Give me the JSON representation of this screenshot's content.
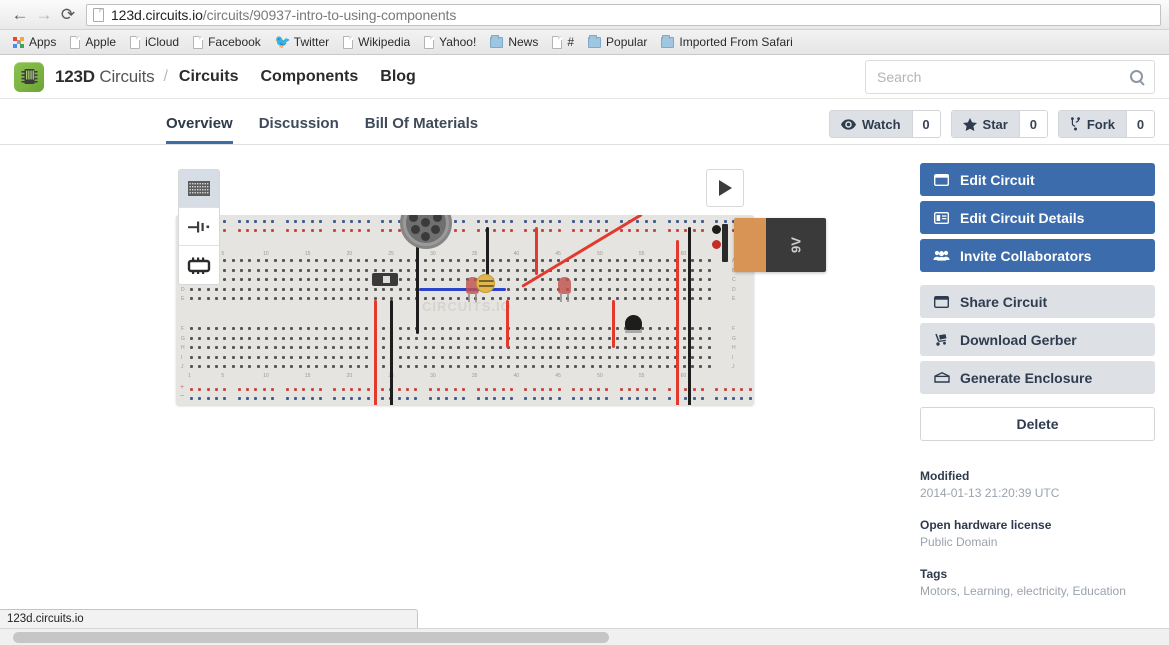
{
  "browser": {
    "back_icon": "back-arrow-icon",
    "forward_icon": "forward-arrow-icon",
    "reload_icon": "reload-icon",
    "url_main": "123d.circuits.io",
    "url_path": "/circuits/90937-intro-to-using-components",
    "bookmarks": [
      {
        "label": "Apps",
        "icon": "apps-grid-icon"
      },
      {
        "label": "Apple",
        "icon": "document-icon"
      },
      {
        "label": "iCloud",
        "icon": "document-icon"
      },
      {
        "label": "Facebook",
        "icon": "document-icon"
      },
      {
        "label": "Twitter",
        "icon": "twitter-bird-icon"
      },
      {
        "label": "Wikipedia",
        "icon": "document-icon"
      },
      {
        "label": "Yahoo!",
        "icon": "document-icon"
      },
      {
        "label": "News",
        "icon": "folder-icon"
      },
      {
        "label": "#",
        "icon": "document-icon"
      },
      {
        "label": "Popular",
        "icon": "folder-icon"
      },
      {
        "label": "Imported From Safari",
        "icon": "folder-icon"
      }
    ],
    "status_text": "123d.circuits.io"
  },
  "header": {
    "brand_strong": "123D",
    "brand_light": "Circuits",
    "separator": "/",
    "nav": [
      {
        "label": "Circuits"
      },
      {
        "label": "Components"
      },
      {
        "label": "Blog"
      }
    ],
    "search_placeholder": "Search",
    "search_value": "",
    "search_icon": "search-icon"
  },
  "repo": {
    "tabs": [
      {
        "label": "Overview",
        "active": true
      },
      {
        "label": "Discussion",
        "active": false
      },
      {
        "label": "Bill Of Materials",
        "active": false
      }
    ],
    "social": [
      {
        "label": "Watch",
        "count": "0",
        "icon": "eye-icon"
      },
      {
        "label": "Star",
        "count": "0",
        "icon": "star-icon"
      },
      {
        "label": "Fork",
        "count": "0",
        "icon": "fork-icon"
      }
    ]
  },
  "viewer": {
    "tools": [
      {
        "name": "breadboard-view",
        "icon": "breadboard-icon",
        "active": true
      },
      {
        "name": "schematic-view",
        "icon": "schematic-icon",
        "active": false
      },
      {
        "name": "pcb-view",
        "icon": "chip-icon",
        "active": false
      }
    ],
    "play_icon": "play-triangle-icon",
    "watermark": "CIRCUITS.IO",
    "battery_label": "9V",
    "row_letters_top": [
      "A",
      "B",
      "C",
      "D",
      "E"
    ],
    "row_letters_bottom": [
      "F",
      "G",
      "H",
      "I",
      "J"
    ],
    "column_numbers": [
      "1",
      "5",
      "10",
      "15",
      "20",
      "25",
      "30",
      "35",
      "40",
      "45",
      "50",
      "55",
      "60"
    ],
    "rail_plus": "+",
    "rail_minus": "−"
  },
  "sidebar": {
    "primary_actions": [
      {
        "label": "Edit Circuit",
        "icon": "window-icon"
      },
      {
        "label": "Edit Circuit Details",
        "icon": "details-panel-icon"
      },
      {
        "label": "Invite Collaborators",
        "icon": "people-icon"
      }
    ],
    "secondary_actions": [
      {
        "label": "Share Circuit",
        "icon": "window-icon"
      },
      {
        "label": "Download Gerber",
        "icon": "handtruck-icon"
      },
      {
        "label": "Generate Enclosure",
        "icon": "box-icon"
      }
    ],
    "delete_label": "Delete",
    "meta": [
      {
        "label": "Modified",
        "value": "2014-01-13 21:20:39 UTC"
      },
      {
        "label": "Open hardware license",
        "value": "Public Domain"
      },
      {
        "label": "Tags",
        "value": "Motors, Learning, electricity, Education"
      }
    ]
  },
  "colors": {
    "primary_blue": "#3c6cab",
    "tab_underline": "#3a6ea5",
    "secondary_grey": "#dde1e6",
    "brand_green": "#7cb342",
    "wire_red": "#e23b2e",
    "wire_black": "#1d1d1d",
    "wire_blue": "#2b43c9",
    "battery_orange": "#d89455"
  }
}
